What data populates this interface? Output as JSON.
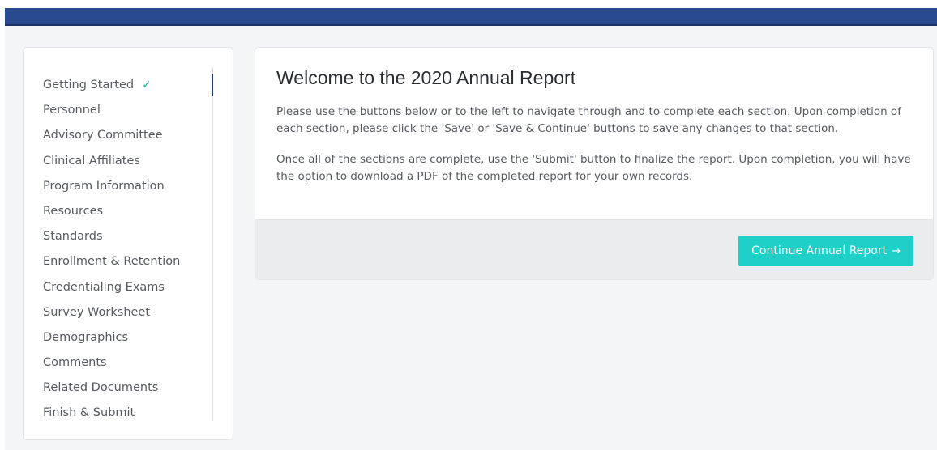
{
  "sidebar": {
    "items": [
      {
        "label": "Getting Started",
        "completed": true
      },
      {
        "label": "Personnel"
      },
      {
        "label": "Advisory Committee"
      },
      {
        "label": "Clinical Affiliates"
      },
      {
        "label": "Program Information"
      },
      {
        "label": "Resources"
      },
      {
        "label": "Standards"
      },
      {
        "label": "Enrollment & Retention"
      },
      {
        "label": "Credentialing Exams"
      },
      {
        "label": "Survey Worksheet"
      },
      {
        "label": "Demographics"
      },
      {
        "label": "Comments"
      },
      {
        "label": "Related Documents"
      },
      {
        "label": "Finish & Submit"
      }
    ],
    "check_icon": "check-icon"
  },
  "main": {
    "title": "Welcome to the 2020 Annual Report",
    "paragraphs": [
      "Please use the buttons below or to the left to navigate through and to complete each section. Upon completion of each section, please click the 'Save' or 'Save & Continue' buttons to save any changes to that section.",
      "Once all of the sections are complete, use the 'Submit' button to finalize the report. Upon completion, you will have the option to download a PDF of the completed report for your own records."
    ],
    "continue_button": {
      "label": "Continue Annual Report",
      "icon": "arrow-right-icon"
    }
  },
  "colors": {
    "header": "#2a4a8f",
    "accent": "#1fd0c9",
    "check": "#2bb3a3",
    "active_rail": "#1d3a7a"
  }
}
